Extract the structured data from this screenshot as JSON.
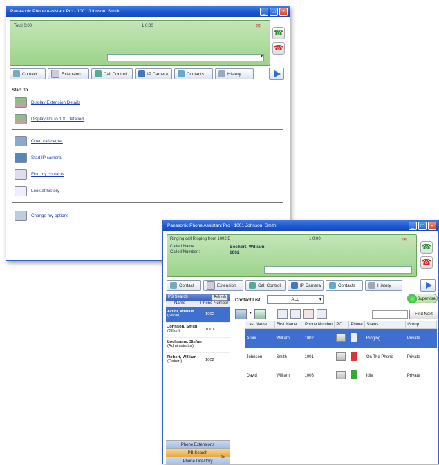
{
  "window1": {
    "title": "Panasonic Phone Assistant Pro - 1001 Johnson, Smith",
    "green": {
      "label_left": "Total 0:00",
      "label_mid": "1 0:00",
      "dash": "———"
    },
    "tabs": [
      "Contact",
      "Extension",
      "Call Control",
      "IP Camera",
      "Contacts",
      "History"
    ],
    "section_title": "Start To",
    "links_group1": [
      "Display Extension Details",
      "Display Up To 100 Detailed"
    ],
    "links_group2": [
      "Open call center",
      "Start IP camera",
      "Find my contacts",
      "Look at history"
    ],
    "links_group3": [
      "Change my options"
    ]
  },
  "window2": {
    "title": "Panasonic Phone Assistant Pro - 1001 Johnson, Smith",
    "green": {
      "status": "Ringing call Ringing from 1002 B",
      "caller_name_label": "Called Name :",
      "caller_number_label": "Called Number :",
      "caller_name": "Bechert, William",
      "caller_number": "1002",
      "mid": "1 0:00"
    },
    "tabs": [
      "Contact",
      "Extension",
      "Call Control",
      "IP Camera",
      "Contacts",
      "History"
    ],
    "left_panel": {
      "header": "PB Search",
      "header_btn": "Refresh",
      "col_name": "Name",
      "col_phone": "Phone Number",
      "rows": [
        {
          "name": "Aruni, William",
          "sub": "(Sarah)",
          "number": "1002"
        },
        {
          "name": "Johnson, Smith",
          "sub": "(Jillion)",
          "number": "1001"
        },
        {
          "name": "Lochsame, Stefan",
          "sub": "(Administrator)",
          "number": ""
        },
        {
          "name": "Robert, William",
          "sub": "(Robert)",
          "number": "1002"
        }
      ],
      "buttons": [
        "Phone Extensions",
        "PB Search",
        "Phone Directory"
      ],
      "page_indicator": "3x"
    },
    "main": {
      "list_label": "Contact List",
      "list_value": "ALL",
      "action_btn": "Supervise",
      "find_btn": "Find Next",
      "columns": [
        "Last Name",
        "First Name",
        "Phone Number",
        "PC",
        "Phone",
        "Status",
        "Group"
      ],
      "rows": [
        {
          "last": "Aruni",
          "first": "William",
          "number": "1002",
          "status": "Ringing",
          "group": "Private"
        },
        {
          "last": "Johnson",
          "first": "Smith",
          "number": "1001",
          "status": "On The Phone",
          "group": "Private"
        },
        {
          "last": "David",
          "first": "William",
          "number": "1008",
          "status": "Idle",
          "group": "Private"
        }
      ]
    }
  },
  "colors": {
    "title_blue": "#1c55cc",
    "green_panel": "#a8d896",
    "selection": "#3e6fcf"
  }
}
